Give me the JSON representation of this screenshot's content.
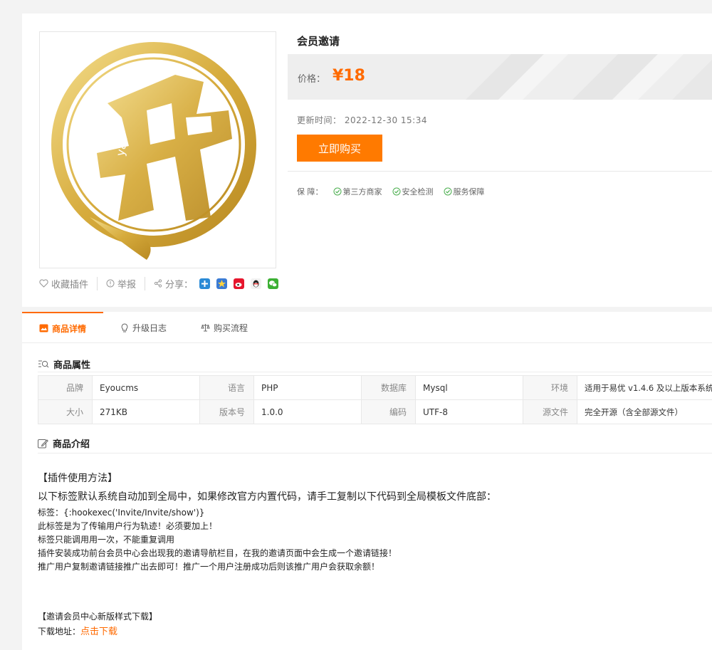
{
  "product": {
    "title": "会员邀请",
    "price_label": "价格：",
    "price": "¥18",
    "update_label": "更新时间：",
    "update_time": "2022-12-30 15:34",
    "buy_button": "立即购买",
    "guarantee_label": "保 障：",
    "guarantees": [
      "第三方商家",
      "安全检测",
      "服务保障"
    ]
  },
  "actions": {
    "favorite": "收藏插件",
    "report": "举报",
    "share": "分享："
  },
  "share_icons": [
    "qzone-icon",
    "qq-star-icon",
    "weibo-icon",
    "qq-icon",
    "wechat-icon"
  ],
  "tabs": [
    "商品详情",
    "升级日志",
    "购买流程"
  ],
  "attributes": {
    "section_title": "商品属性",
    "rows": [
      [
        [
          "品牌",
          "Eyoucms"
        ],
        [
          "语言",
          "PHP"
        ],
        [
          "数据库",
          "Mysql"
        ],
        [
          "环境",
          "适用于易优 v1.4.6 及以上版本系统"
        ]
      ],
      [
        [
          "大小",
          "271KB"
        ],
        [
          "版本号",
          "1.0.0"
        ],
        [
          "编码",
          "UTF-8"
        ],
        [
          "源文件",
          "完全开源（含全部源文件）"
        ]
      ]
    ]
  },
  "intro": {
    "section_title": "商品介绍",
    "heading": "【插件使用方法】",
    "lead": "以下标签默认系统自动加到全局中，如果修改官方内置代码，请手工复制以下代码到全局模板文件底部：",
    "lines": [
      "标签：{:hookexec('Invite/Invite/show')}",
      "此标签是为了传输用户行为轨迹！必须要加上！",
      "标签只能调用用一次，不能重复调用",
      "插件安装成功前台会员中心会出现我的邀请导航栏目，在我的邀请页面中会生成一个邀请链接！",
      "推广用户复制邀请链接推广出去即可！推广一个用户注册成功后则该推广用户会获取余额！"
    ],
    "download_heading": "【邀请会员中心新版样式下载】",
    "download_label": "下载地址：",
    "download_link": "点击下载"
  },
  "colors": {
    "accent": "#ff6a00",
    "button": "#ff7a00",
    "logo_gold": "#d6ab3c"
  }
}
